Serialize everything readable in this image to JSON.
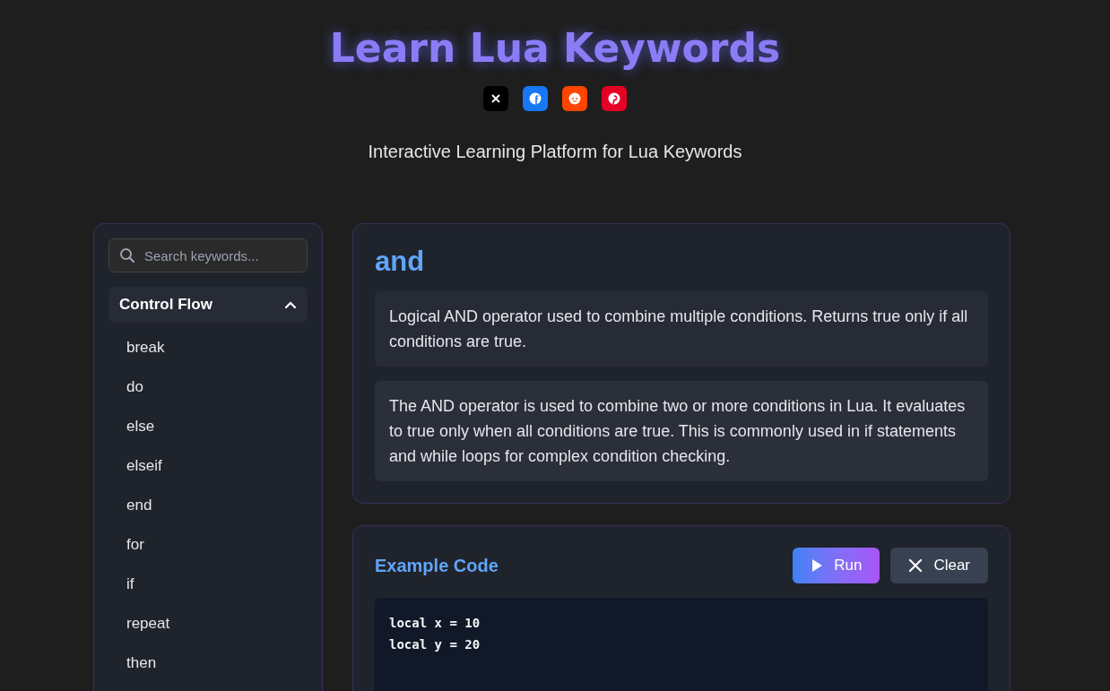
{
  "header": {
    "title": "Learn Lua Keywords",
    "subtitle": "Interactive Learning Platform for Lua Keywords",
    "share_buttons": [
      {
        "kind": "x"
      },
      {
        "kind": "facebook"
      },
      {
        "kind": "reddit"
      },
      {
        "kind": "pinterest"
      }
    ]
  },
  "sidebar": {
    "search": {
      "placeholder": "Search keywords..."
    },
    "categories": [
      {
        "label": "Control Flow",
        "expanded": true,
        "items": [
          "break",
          "do",
          "else",
          "elseif",
          "end",
          "for",
          "if",
          "repeat",
          "then"
        ]
      }
    ]
  },
  "keyword": {
    "name": "and",
    "summary": "Logical AND operator used to combine multiple conditions. Returns true only if all conditions are true.",
    "details": "The AND operator is used to combine two or more conditions in Lua. It evaluates to true only when all conditions are true. This is commonly used in if statements and while loops for complex condition checking."
  },
  "example": {
    "title": "Example Code",
    "buttons": [
      {
        "kind": "run",
        "label": "Run"
      },
      {
        "kind": "clear",
        "label": "Clear"
      }
    ],
    "code": [
      "local x = 10",
      "local y = 20"
    ]
  }
}
